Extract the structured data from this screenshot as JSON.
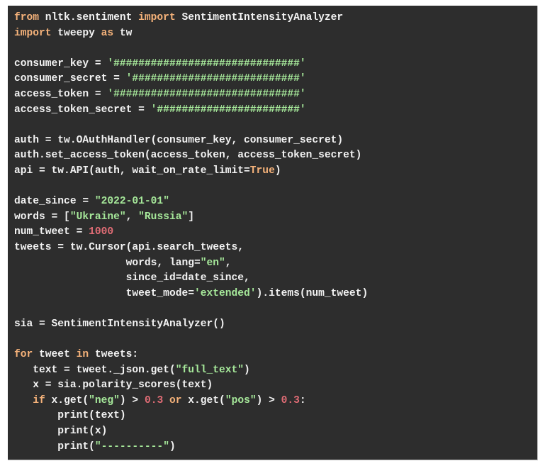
{
  "code_block": {
    "language": "python",
    "colors": {
      "background": "#2d2d2d",
      "text": "#f2f2f2",
      "keyword": "#f5b27a",
      "string": "#a6e89a",
      "number": "#e06c75"
    },
    "lines": [
      [
        {
          "t": "kw",
          "v": "from"
        },
        {
          "t": "p",
          "v": " nltk.sentiment "
        },
        {
          "t": "kw",
          "v": "import"
        },
        {
          "t": "p",
          "v": " SentimentIntensityAnalyzer"
        }
      ],
      [
        {
          "t": "kw",
          "v": "import"
        },
        {
          "t": "p",
          "v": " tweepy "
        },
        {
          "t": "kw",
          "v": "as"
        },
        {
          "t": "p",
          "v": " tw"
        }
      ],
      [],
      [
        {
          "t": "p",
          "v": "consumer_key = "
        },
        {
          "t": "str",
          "v": "'##############################'"
        }
      ],
      [
        {
          "t": "p",
          "v": "consumer_secret = "
        },
        {
          "t": "str",
          "v": "'###########################'"
        }
      ],
      [
        {
          "t": "p",
          "v": "access_token = "
        },
        {
          "t": "str",
          "v": "'##############################'"
        }
      ],
      [
        {
          "t": "p",
          "v": "access_token_secret = "
        },
        {
          "t": "str",
          "v": "'#######################'"
        }
      ],
      [],
      [
        {
          "t": "p",
          "v": "auth = tw.OAuthHandler(consumer_key, consumer_secret)"
        }
      ],
      [
        {
          "t": "p",
          "v": "auth.set_access_token(access_token, access_token_secret)"
        }
      ],
      [
        {
          "t": "p",
          "v": "api = tw.API(auth, wait_on_rate_limit="
        },
        {
          "t": "const",
          "v": "True"
        },
        {
          "t": "p",
          "v": ")"
        }
      ],
      [],
      [
        {
          "t": "p",
          "v": "date_since = "
        },
        {
          "t": "str",
          "v": "\"2022-01-01\""
        }
      ],
      [
        {
          "t": "p",
          "v": "words = ["
        },
        {
          "t": "str",
          "v": "\"Ukraine\""
        },
        {
          "t": "p",
          "v": ", "
        },
        {
          "t": "str",
          "v": "\"Russia\""
        },
        {
          "t": "p",
          "v": "]"
        }
      ],
      [
        {
          "t": "p",
          "v": "num_tweet = "
        },
        {
          "t": "num",
          "v": "1000"
        }
      ],
      [
        {
          "t": "p",
          "v": "tweets = tw.Cursor(api.search_tweets,"
        }
      ],
      [
        {
          "t": "p",
          "v": "                  words, lang="
        },
        {
          "t": "str",
          "v": "\"en\""
        },
        {
          "t": "p",
          "v": ","
        }
      ],
      [
        {
          "t": "p",
          "v": "                  since_id=date_since,"
        }
      ],
      [
        {
          "t": "p",
          "v": "                  tweet_mode="
        },
        {
          "t": "str",
          "v": "'extended'"
        },
        {
          "t": "p",
          "v": ").items(num_tweet)"
        }
      ],
      [],
      [
        {
          "t": "p",
          "v": "sia = SentimentIntensityAnalyzer()"
        }
      ],
      [],
      [
        {
          "t": "kw",
          "v": "for"
        },
        {
          "t": "p",
          "v": " tweet "
        },
        {
          "t": "kw",
          "v": "in"
        },
        {
          "t": "p",
          "v": " tweets:"
        }
      ],
      [
        {
          "t": "p",
          "v": "   text = tweet._json.get("
        },
        {
          "t": "str",
          "v": "\"full_text\""
        },
        {
          "t": "p",
          "v": ")"
        }
      ],
      [
        {
          "t": "p",
          "v": "   x = sia.polarity_scores(text)"
        }
      ],
      [
        {
          "t": "p",
          "v": "   "
        },
        {
          "t": "kw",
          "v": "if"
        },
        {
          "t": "p",
          "v": " x.get("
        },
        {
          "t": "str",
          "v": "\"neg\""
        },
        {
          "t": "p",
          "v": ") > "
        },
        {
          "t": "num",
          "v": "0.3"
        },
        {
          "t": "p",
          "v": " "
        },
        {
          "t": "kw",
          "v": "or"
        },
        {
          "t": "p",
          "v": " x.get("
        },
        {
          "t": "str",
          "v": "\"pos\""
        },
        {
          "t": "p",
          "v": ") > "
        },
        {
          "t": "num",
          "v": "0.3"
        },
        {
          "t": "p",
          "v": ":"
        }
      ],
      [
        {
          "t": "p",
          "v": "       print(text)"
        }
      ],
      [
        {
          "t": "p",
          "v": "       print(x)"
        }
      ],
      [
        {
          "t": "p",
          "v": "       print("
        },
        {
          "t": "str",
          "v": "\"----------\""
        },
        {
          "t": "p",
          "v": ")"
        }
      ]
    ]
  }
}
